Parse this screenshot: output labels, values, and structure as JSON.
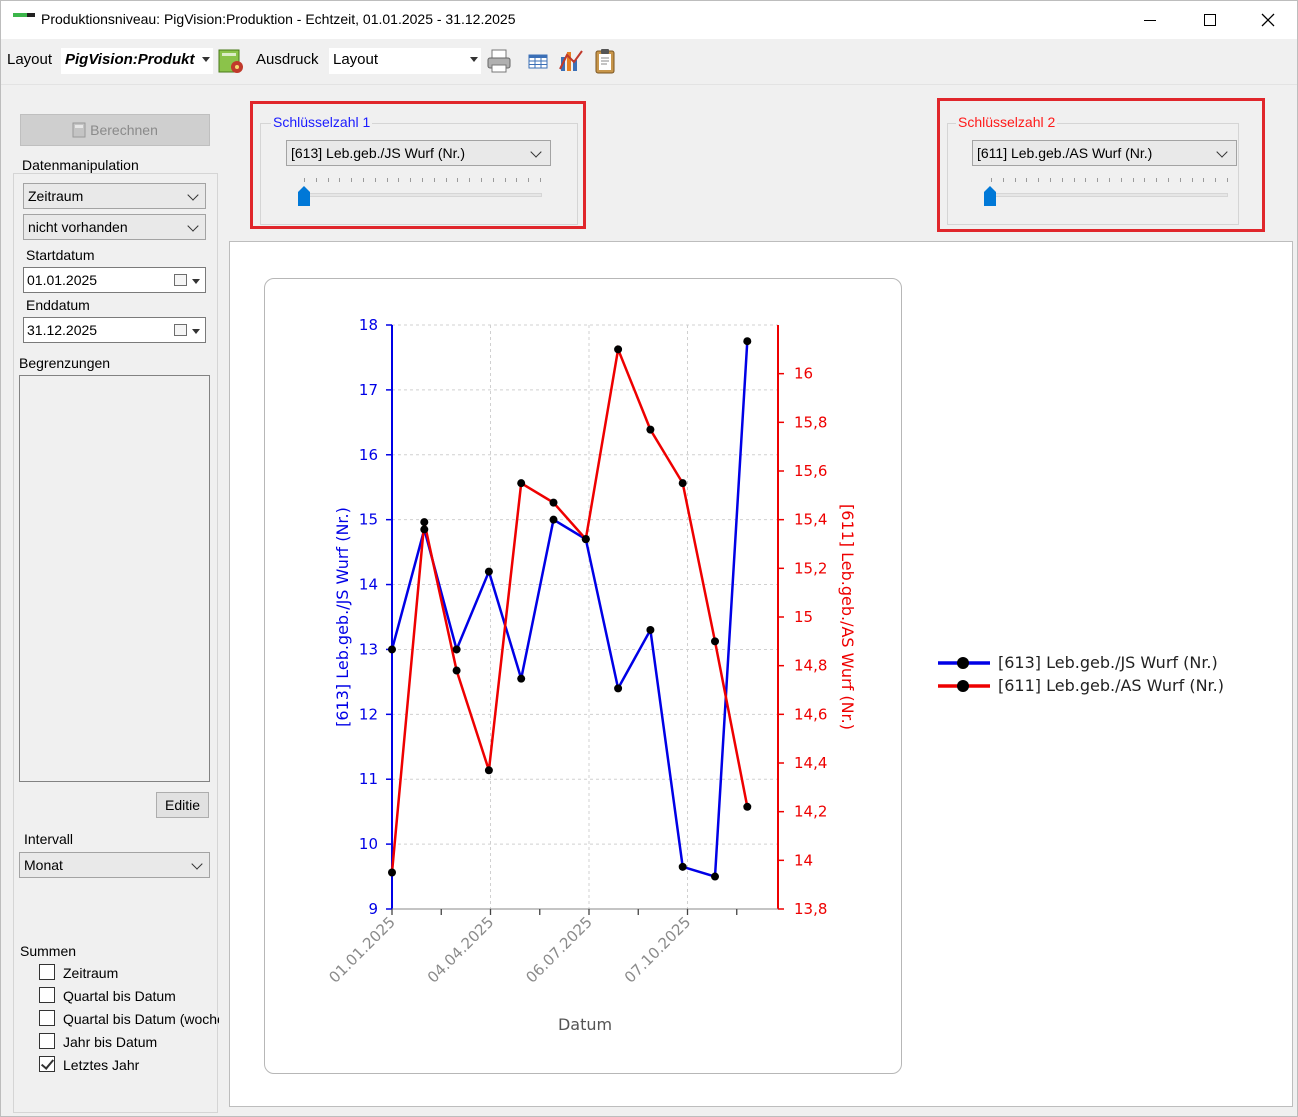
{
  "window": {
    "title": "Produktionsniveau: PigVision:Produktion - Echtzeit, 01.01.2025 - 31.12.2025",
    "minimize_glyph": "—",
    "maximize_glyph": "☐",
    "close_glyph": "✕"
  },
  "toolbar": {
    "layout_label": "Layout",
    "layout_value": "PigVision:Produkt",
    "print_label": "Ausdruck",
    "print_value": "Layout",
    "icons": [
      "layout-settings-icon",
      "printer-icon",
      "table-icon",
      "chart-icon",
      "clipboard-icon"
    ]
  },
  "left_panel": {
    "calculate_button": "Berechnen",
    "data_manipulation_label": "Datenmanipulation",
    "period_select": "Zeitraum",
    "availability_select": "nicht vorhanden",
    "start_label": "Startdatum",
    "start_value": "01.01.2025",
    "end_label": "Enddatum",
    "end_value": "31.12.2025",
    "limits_label": "Begrenzungen",
    "edit_button": "Editie",
    "interval_label": "Intervall",
    "interval_value": "Monat",
    "sums_label": "Summen",
    "sums": [
      {
        "label": "Zeitraum",
        "checked": false
      },
      {
        "label": "Quartal bis Datum",
        "checked": false
      },
      {
        "label": "Quartal bis Datum (woche",
        "checked": false
      },
      {
        "label": "Jahr bis Datum",
        "checked": false
      },
      {
        "label": "Letztes Jahr",
        "checked": true
      }
    ]
  },
  "key1": {
    "label": "Schlüsselzahl 1",
    "value": "[613] Leb.geb./JS Wurf (Nr.)",
    "color": "#1a1aff",
    "slider_position": 0
  },
  "key2": {
    "label": "Schlüsselzahl 2",
    "value": "[611] Leb.geb./AS Wurf (Nr.)",
    "color": "#ff1a1a",
    "slider_position": 0
  },
  "colors": {
    "series1": "#0000e6",
    "series2": "#ee0000",
    "highlight": "#e0262b",
    "slider": "#0078d7"
  },
  "chart_data": {
    "type": "line",
    "xlabel": "Datum",
    "ylabel_left": "[613] Leb.geb./JS Wurf (Nr.)",
    "ylabel_right": "[611] Leb.geb./AS Wurf (Nr.)",
    "x_tick_labels": [
      "01.01.2025",
      "04.04.2025",
      "06.07.2025",
      "07.10.2025"
    ],
    "ylim_left": [
      9,
      18
    ],
    "yticks_left": [
      "9",
      "10",
      "11",
      "12",
      "13",
      "14",
      "15",
      "16",
      "17",
      "18"
    ],
    "ylim_right": [
      13.8,
      16.2
    ],
    "yticks_right": [
      "13,8",
      "14",
      "14,2",
      "14,4",
      "14,6",
      "14,8",
      "15",
      "15,2",
      "15,4",
      "15,6",
      "15,8",
      "16"
    ],
    "grid": true,
    "legend_position": "right",
    "x": [
      "2025-01-01",
      "2025-02-01",
      "2025-03-01",
      "2025-04-01",
      "2025-05-01",
      "2025-06-01",
      "2025-07-01",
      "2025-08-01",
      "2025-09-01",
      "2025-10-01",
      "2025-11-01",
      "2025-12-01"
    ],
    "series": [
      {
        "name": "[613] Leb.geb./JS Wurf (Nr.)",
        "axis": "left",
        "color": "#0000e6",
        "values": [
          13.0,
          14.85,
          13.0,
          14.2,
          12.55,
          15.0,
          14.7,
          12.4,
          13.3,
          9.65,
          9.5,
          17.75
        ]
      },
      {
        "name": "[611] Leb.geb./AS Wurf (Nr.)",
        "axis": "right",
        "color": "#ee0000",
        "values": [
          13.95,
          15.39,
          14.78,
          14.37,
          15.55,
          15.47,
          15.32,
          16.1,
          15.77,
          15.55,
          14.9,
          14.22
        ]
      }
    ]
  }
}
